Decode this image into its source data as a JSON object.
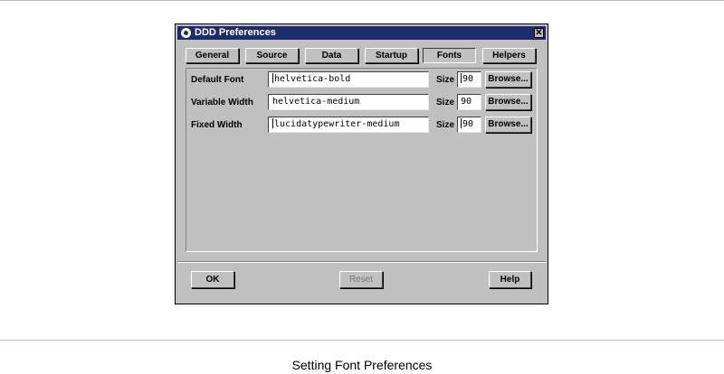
{
  "window": {
    "title": "DDD Preferences",
    "close_glyph": "✕"
  },
  "tabs": [
    {
      "label": "General"
    },
    {
      "label": "Source"
    },
    {
      "label": "Data"
    },
    {
      "label": "Startup"
    },
    {
      "label": "Fonts",
      "active": true
    },
    {
      "label": "Helpers"
    }
  ],
  "fonts": {
    "rows": [
      {
        "label": "Default Font",
        "value": "helvetica-bold",
        "size_label": "Size",
        "size": "90",
        "browse_label": "Browse..."
      },
      {
        "label": "Variable Width",
        "value": "helvetica-medium",
        "size_label": "Size",
        "size": "90",
        "browse_label": "Browse..."
      },
      {
        "label": "Fixed Width",
        "value": "lucidatypewriter-medium",
        "size_label": "Size",
        "size": "90",
        "browse_label": "Browse..."
      }
    ]
  },
  "buttons": {
    "ok": "OK",
    "reset": "Reset",
    "help": "Help"
  },
  "caption": "Setting Font Preferences",
  "icons": {
    "title_icon": "ddd-app-icon",
    "close_icon": "close-icon"
  }
}
